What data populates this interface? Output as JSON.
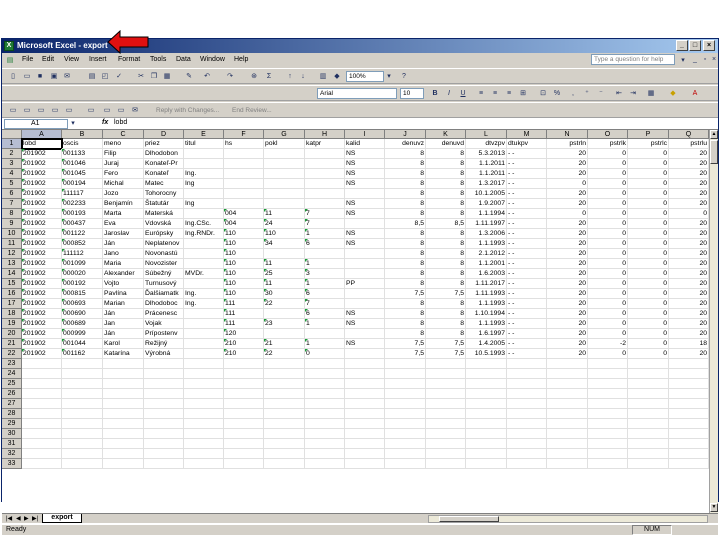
{
  "window": {
    "title": "Microsoft Excel - export"
  },
  "menu": [
    "File",
    "Edit",
    "View",
    "Insert",
    "Format",
    "Tools",
    "Data",
    "Window",
    "Help"
  ],
  "help_placeholder": "Type a question for help",
  "toolbar": {
    "zoom": "100%",
    "font_name": "Arial",
    "font_size": "10",
    "reply_with_changes": "Reply with Changes...",
    "end_review": "End Review..."
  },
  "formula_bar": {
    "cell_ref": "A1",
    "fx": "fx",
    "value": "lobd"
  },
  "columns": [
    "A",
    "B",
    "C",
    "D",
    "E",
    "F",
    "G",
    "H",
    "I",
    "J",
    "K",
    "L",
    "M",
    "N",
    "O",
    "P",
    "Q"
  ],
  "row_numbers": [
    "1",
    "2",
    "3",
    "4",
    "5",
    "6",
    "7",
    "8",
    "9",
    "10",
    "11",
    "12",
    "13",
    "14",
    "15",
    "16",
    "17",
    "18",
    "19",
    "20",
    "21",
    "22",
    "23",
    "24",
    "25",
    "26",
    "27",
    "28",
    "29",
    "30",
    "31",
    "32",
    "33"
  ],
  "rows": [
    [
      "lobd",
      "oscis",
      "meno",
      "priez",
      "titul",
      "hs",
      "pokl",
      "katpr",
      "kalid",
      "denuvz",
      "denuvd",
      "dtvzpv",
      "dtukpv",
      "pstrln",
      "pstrlk",
      "pstrlc",
      "pstrlu"
    ],
    [
      "201902",
      "001133",
      "Filip",
      "Dlhodobon",
      "",
      "",
      "",
      "",
      "NS",
      "8",
      "8",
      "5.3.2013",
      "-  -",
      "20",
      "0",
      "0",
      "20"
    ],
    [
      "201902",
      "001046",
      "Juraj",
      "Konateľ-Pr",
      "",
      "",
      "",
      "",
      "NS",
      "8",
      "8",
      "1.1.2011",
      "-  -",
      "20",
      "0",
      "0",
      "20"
    ],
    [
      "201902",
      "001045",
      "Fero",
      "Konateľ",
      "Ing.",
      "",
      "",
      "",
      "NS",
      "8",
      "8",
      "1.1.2011",
      "-  -",
      "20",
      "0",
      "0",
      "20"
    ],
    [
      "201902",
      "000194",
      "Michal",
      "Matec",
      "Ing",
      "",
      "",
      "",
      "NS",
      "8",
      "8",
      "1.3.2017",
      "-  -",
      "0",
      "0",
      "0",
      "20"
    ],
    [
      "201902",
      "111117",
      "Jozo",
      "Tohorocny",
      "",
      "",
      "",
      "",
      "",
      "8",
      "8",
      "10.1.2005",
      "-  -",
      "20",
      "0",
      "0",
      "20"
    ],
    [
      "201902",
      "002233",
      "Benjamín",
      "Štatutár",
      "Ing",
      "",
      "",
      "",
      "NS",
      "8",
      "8",
      "1.9.2007",
      "-  -",
      "20",
      "0",
      "0",
      "20"
    ],
    [
      "201902",
      "000193",
      "Marta",
      "Materská",
      "",
      "004",
      "11",
      "7",
      "NS",
      "8",
      "8",
      "1.1.1994",
      "-  -",
      "0",
      "0",
      "0",
      "0"
    ],
    [
      "201902",
      "000437",
      "Eva",
      "Vdovská",
      "Ing.CSc.",
      "004",
      "24",
      "7",
      "",
      "8,5",
      "8,5",
      "1.11.1997",
      "-  -",
      "20",
      "0",
      "0",
      "20"
    ],
    [
      "201902",
      "001122",
      "Jaroslav",
      "Európsky",
      "Ing.RNDr.",
      "110",
      "110",
      "1",
      "NS",
      "8",
      "8",
      "1.3.2006",
      "-  -",
      "20",
      "0",
      "0",
      "20"
    ],
    [
      "201902",
      "000852",
      "Ján",
      "Neplatenov",
      "",
      "110",
      "34",
      "6",
      "NS",
      "8",
      "8",
      "1.1.1993",
      "-  -",
      "20",
      "0",
      "0",
      "20"
    ],
    [
      "201902",
      "111112",
      "Jano",
      "Novonastú",
      "",
      "110",
      "",
      "",
      "",
      "8",
      "8",
      "2.1.2012",
      "-  -",
      "20",
      "0",
      "0",
      "20"
    ],
    [
      "201902",
      "001099",
      "Maria",
      "Novozister",
      "",
      "110",
      "11",
      "1",
      "",
      "8",
      "8",
      "1.1.2001",
      "-  -",
      "20",
      "0",
      "0",
      "20"
    ],
    [
      "201902",
      "000020",
      "Alexander",
      "Súbežný",
      "MVDr.",
      "110",
      "25",
      "3",
      "",
      "8",
      "8",
      "1.6.2003",
      "-  -",
      "20",
      "0",
      "0",
      "20"
    ],
    [
      "201902",
      "000192",
      "Vojto",
      "Turnusový",
      "",
      "110",
      "11",
      "1",
      "PP",
      "8",
      "8",
      "1.11.2017",
      "-  -",
      "20",
      "0",
      "0",
      "20"
    ],
    [
      "201902",
      "000815",
      "Pavlína",
      "Ďalšiamatk",
      "Ing.",
      "110",
      "30",
      "6",
      "",
      "7,5",
      "7,5",
      "1.11.1993",
      "-  -",
      "20",
      "0",
      "0",
      "20"
    ],
    [
      "201902",
      "000693",
      "Marian",
      "Dlhodoboc",
      "Ing.",
      "111",
      "22",
      "7",
      "",
      "8",
      "8",
      "1.1.1993",
      "-  -",
      "20",
      "0",
      "0",
      "20"
    ],
    [
      "201902",
      "000690",
      "Ján",
      "Prácenesc",
      "",
      "111",
      "",
      "6",
      "NS",
      "8",
      "8",
      "1.10.1994",
      "-  -",
      "20",
      "0",
      "0",
      "20"
    ],
    [
      "201902",
      "000689",
      "Jan",
      "Vojak",
      "",
      "111",
      "23",
      "1",
      "NS",
      "8",
      "8",
      "1.1.1993",
      "-  -",
      "20",
      "0",
      "0",
      "20"
    ],
    [
      "201902",
      "000999",
      "Ján",
      "Prípostenv",
      "",
      "120",
      "",
      "",
      "",
      "8",
      "8",
      "1.6.1997",
      "-  -",
      "20",
      "0",
      "0",
      "20"
    ],
    [
      "201902",
      "001044",
      "Karol",
      "Režijný",
      "",
      "210",
      "21",
      "1",
      "NS",
      "7,5",
      "7,5",
      "1.4.2005",
      "-  -",
      "20",
      "-2",
      "0",
      "18"
    ],
    [
      "201902",
      "001162",
      "Katarína",
      "Výrobná",
      "",
      "210",
      "22",
      "0",
      "",
      "7,5",
      "7,5",
      "10.5.1993",
      "-  -",
      "20",
      "0",
      "0",
      "20"
    ]
  ],
  "sheet_tab": "export",
  "status": {
    "left": "Ready",
    "num": "NUM"
  }
}
